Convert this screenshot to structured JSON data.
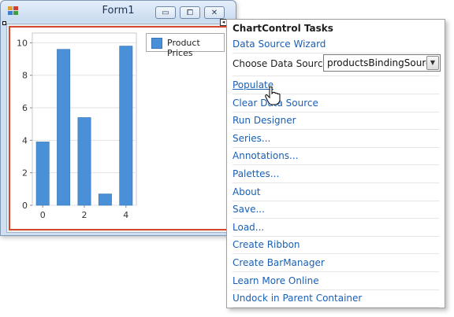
{
  "form": {
    "title": "Form1",
    "controls": {
      "minimize": "▭",
      "maximize": "⧠",
      "close": "✕"
    }
  },
  "colors": {
    "bar": "#4a90d9",
    "selection_border": "#d3492b",
    "link": "#1a5fb4"
  },
  "chart_data": {
    "type": "bar",
    "x": [
      0,
      1,
      2,
      3,
      4
    ],
    "series": [
      {
        "name": "Product Prices",
        "values": [
          3.9,
          9.6,
          5.4,
          0.7,
          9.8
        ]
      }
    ],
    "xticks": [
      "0",
      "2",
      "4"
    ],
    "yticks": [
      "0",
      "2",
      "4",
      "6",
      "8",
      "10"
    ],
    "ylim": [
      0,
      10.6
    ],
    "legend_position": "top-right",
    "grid": true
  },
  "legend": {
    "label": "Product Prices"
  },
  "panel": {
    "title": "ChartControl Tasks",
    "data_source_wizard": "Data Source Wizard",
    "choose_label": "Choose Data Source",
    "choose_value": "productsBindingSource",
    "items": [
      "Populate",
      "Clear Data Source",
      "Run Designer",
      "Series...",
      "Annotations...",
      "Palettes...",
      "About",
      "Save...",
      "Load...",
      "Create Ribbon",
      "Create BarManager",
      "Learn More Online",
      "Undock in Parent Container"
    ]
  }
}
